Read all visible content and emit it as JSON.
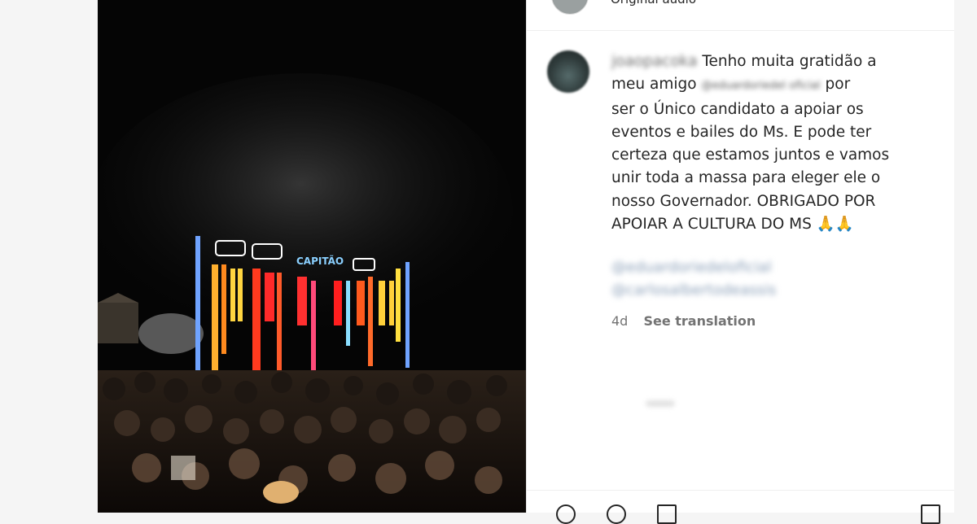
{
  "media": {
    "stage_sign": "CAPITÃO"
  },
  "header": {
    "audio_label": "Original audio"
  },
  "comment": {
    "username": "joaopacoka",
    "text_before": "Tenho muita gratidão a\nmeu amigo ",
    "tagged_name": "@eduardoriedel oficial",
    "text_after": " por\nser o Único candidato a apoiar os\neventos e bailes do Ms. E pode ter\ncerteza que estamos juntos e vamos\nunir toda a massa para eleger ele o\nnosso Governador. OBRIGADO POR\nAPOIAR A CULTURA DO MS 🙏🙏",
    "mentions": [
      "@eduardoriedeloficial",
      "@carlosalbertodeassis"
    ],
    "time": "4d",
    "translate_label": "See translation"
  }
}
